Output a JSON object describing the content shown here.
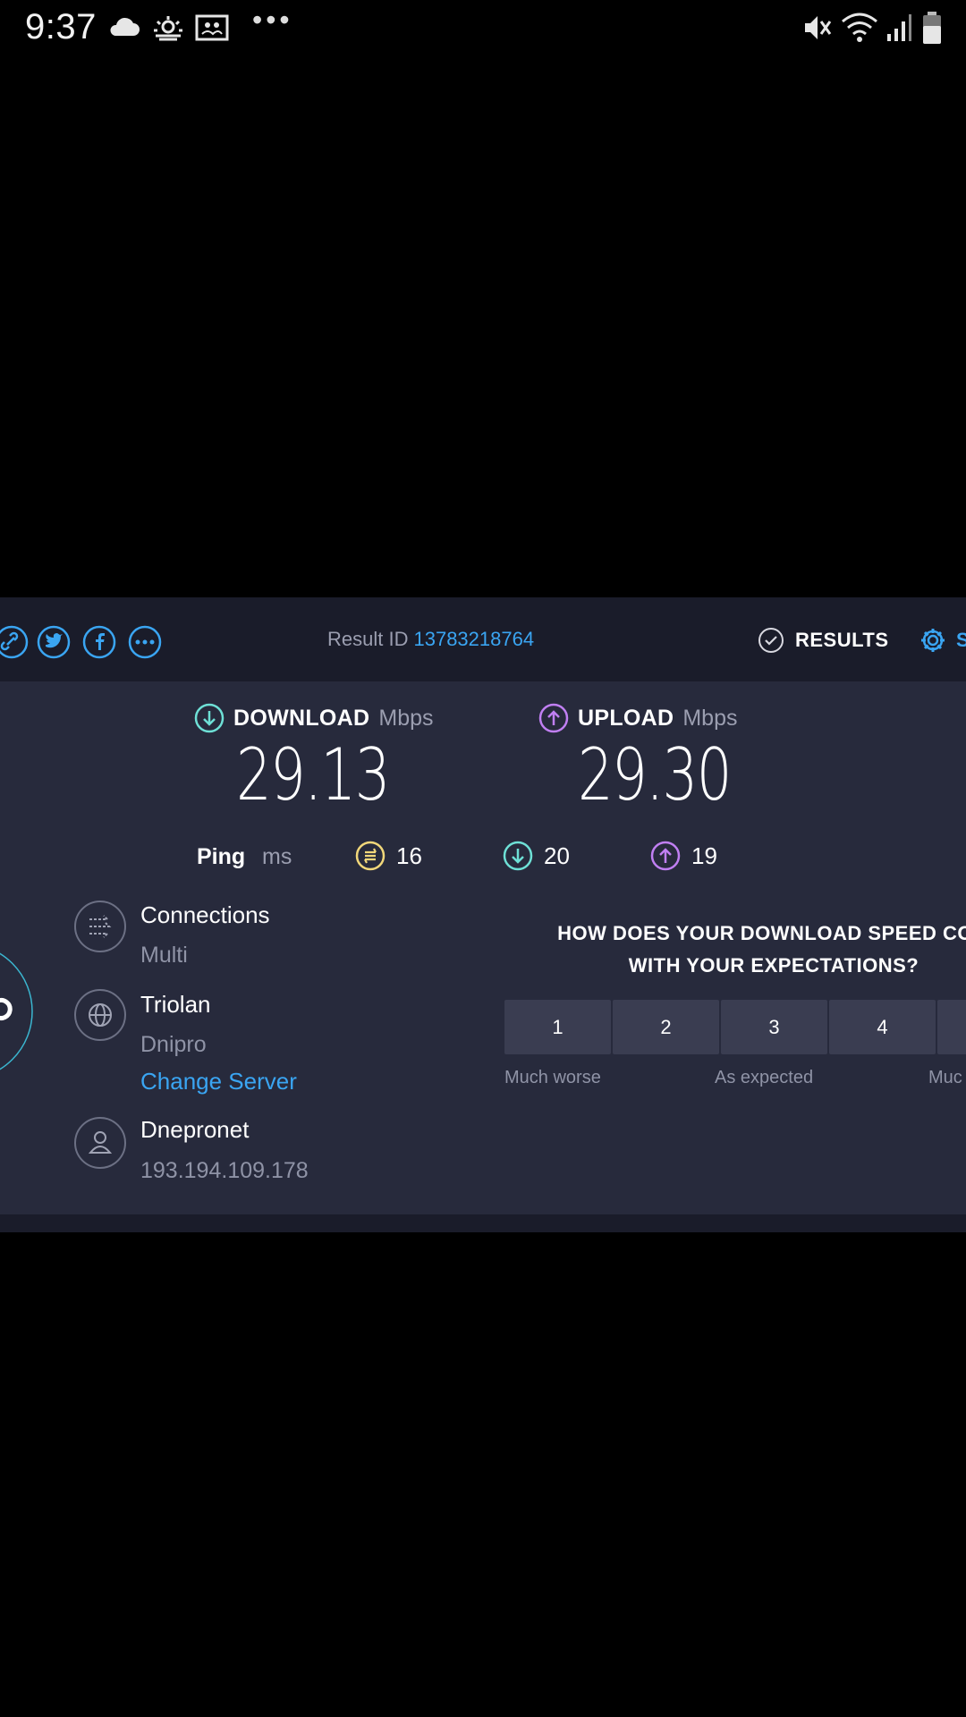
{
  "status_bar": {
    "time": "9:37",
    "left_icons": [
      "cloud-icon",
      "sunrise-icon",
      "picture-icon",
      "more-dots-icon"
    ],
    "more_dots": "•••",
    "right_icons": [
      "mute-icon",
      "wifi-icon",
      "signal-icon",
      "battery-icon"
    ]
  },
  "header": {
    "share_icons": [
      "link-icon",
      "twitter-icon",
      "facebook-icon",
      "more-icon"
    ],
    "result_id_label": "Result ID",
    "result_id_value": "13783218764",
    "results_label": "RESULTS",
    "settings_label": "S"
  },
  "download": {
    "label": "DOWNLOAD",
    "unit": "Mbps",
    "value": "29.13"
  },
  "upload": {
    "label": "UPLOAD",
    "unit": "Mbps",
    "value": "29.30"
  },
  "ping": {
    "label": "Ping",
    "unit": "ms",
    "idle": "16",
    "download": "20",
    "upload": "19"
  },
  "connections": {
    "title": "Connections",
    "value": "Multi"
  },
  "server": {
    "name": "Triolan",
    "location": "Dnipro",
    "change_label": "Change Server"
  },
  "provider": {
    "name": "Dnepronet",
    "ip": "193.194.109.178"
  },
  "survey": {
    "question_line1": "HOW DOES YOUR DOWNLOAD SPEED COM",
    "question_line2": "WITH YOUR EXPECTATIONS?",
    "ratings": [
      "1",
      "2",
      "3",
      "4"
    ],
    "label_low": "Much worse",
    "label_mid": "As expected",
    "label_high": "Muc"
  },
  "colors": {
    "accent_blue": "#3aa5f2",
    "download_teal": "#6ee0d6",
    "upload_purple": "#c07ff2",
    "ping_yellow": "#f1d77a",
    "card_bg": "#272a3c",
    "header_bg": "#1a1c2a"
  }
}
